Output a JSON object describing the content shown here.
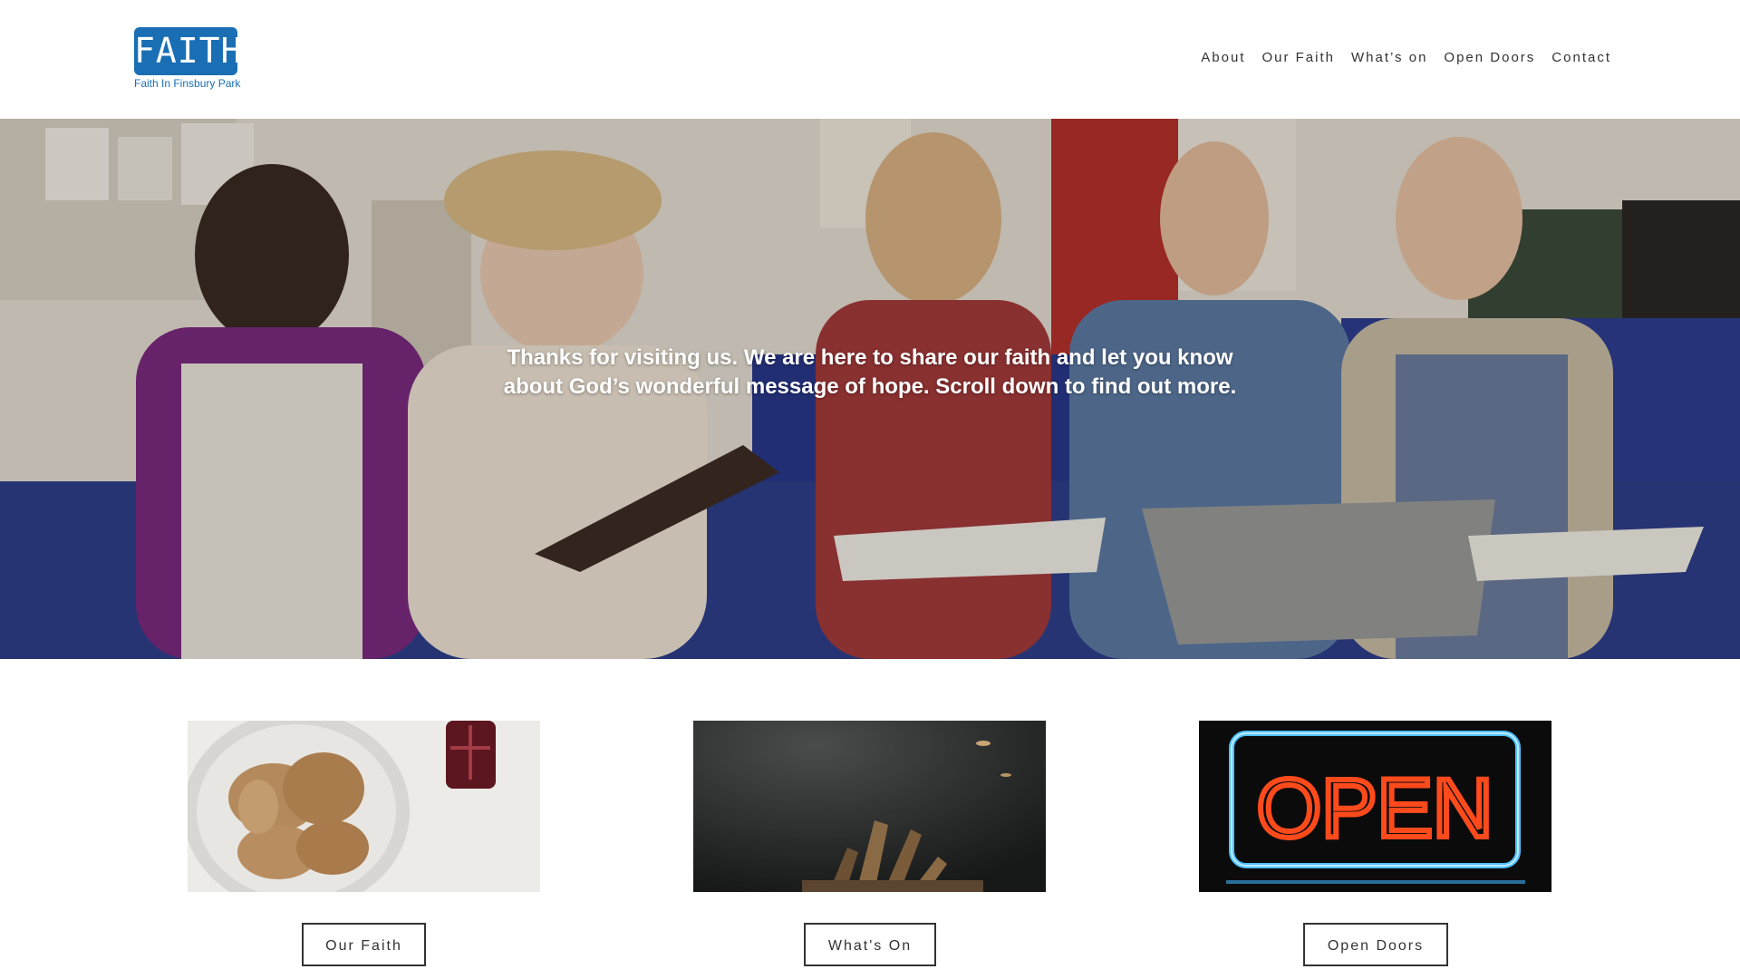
{
  "header": {
    "logo_title": "FAITH",
    "logo_subtitle": "Faith In Finsbury Park",
    "nav": [
      "About",
      "Our Faith",
      "What’s on",
      "Open Doors",
      "Contact"
    ]
  },
  "hero": {
    "text": "Thanks for visiting us. We are here to share our faith and let you know about God’s wonderful message of hope. Scroll down to find out more."
  },
  "cards": [
    {
      "image": "bread-and-wine-image",
      "button": "Our Faith"
    },
    {
      "image": "worship-hands-image",
      "button": "What's On"
    },
    {
      "image": "open-neon-sign-image",
      "button": "Open Doors",
      "sign_text": "OPEN"
    }
  ],
  "colors": {
    "brand_blue": "#1a6fb4",
    "neon_red": "#ff4a1c",
    "neon_blue": "#4fc3ff"
  }
}
